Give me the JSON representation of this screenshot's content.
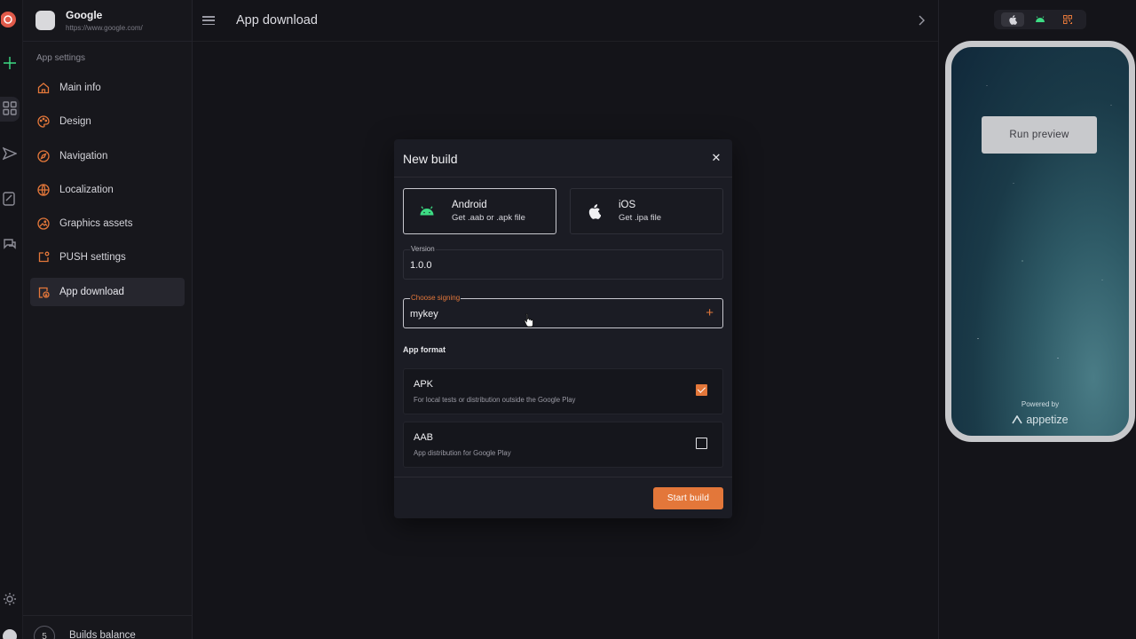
{
  "app": {
    "name": "Google",
    "url": "https://www.google.com/"
  },
  "sidebar": {
    "section_label": "App settings",
    "items": [
      {
        "label": "Main info",
        "icon": "home-icon"
      },
      {
        "label": "Design",
        "icon": "palette-icon"
      },
      {
        "label": "Navigation",
        "icon": "compass-icon"
      },
      {
        "label": "Localization",
        "icon": "globe-icon"
      },
      {
        "label": "Graphics assets",
        "icon": "image-icon"
      },
      {
        "label": "PUSH settings",
        "icon": "notification-icon"
      },
      {
        "label": "App download",
        "icon": "download-icon",
        "active": true
      }
    ],
    "builds_balance": {
      "count": "5",
      "label": "Builds balance"
    }
  },
  "header": {
    "title": "App download"
  },
  "preview": {
    "run_preview_label": "Run preview",
    "powered_by": "Powered by",
    "brand": "appetize"
  },
  "dialog": {
    "title": "New build",
    "platforms": [
      {
        "name": "Android",
        "desc": "Get .aab or .apk file",
        "selected": true
      },
      {
        "name": "iOS",
        "desc": "Get .ipa file",
        "selected": false
      }
    ],
    "version": {
      "label": "Version",
      "value": "1.0.0"
    },
    "signing": {
      "label": "Choose signing",
      "value": "mykey"
    },
    "format_label": "App format",
    "formats": [
      {
        "name": "APK",
        "desc": "For local tests or distribution outside the Google Play",
        "checked": true
      },
      {
        "name": "AAB",
        "desc": "App distribution for Google Play",
        "checked": false
      }
    ],
    "start_label": "Start build"
  },
  "colors": {
    "accent": "#e3773a",
    "android": "#3ddc84",
    "background": "#141419",
    "dialog": "#1b1c24"
  }
}
